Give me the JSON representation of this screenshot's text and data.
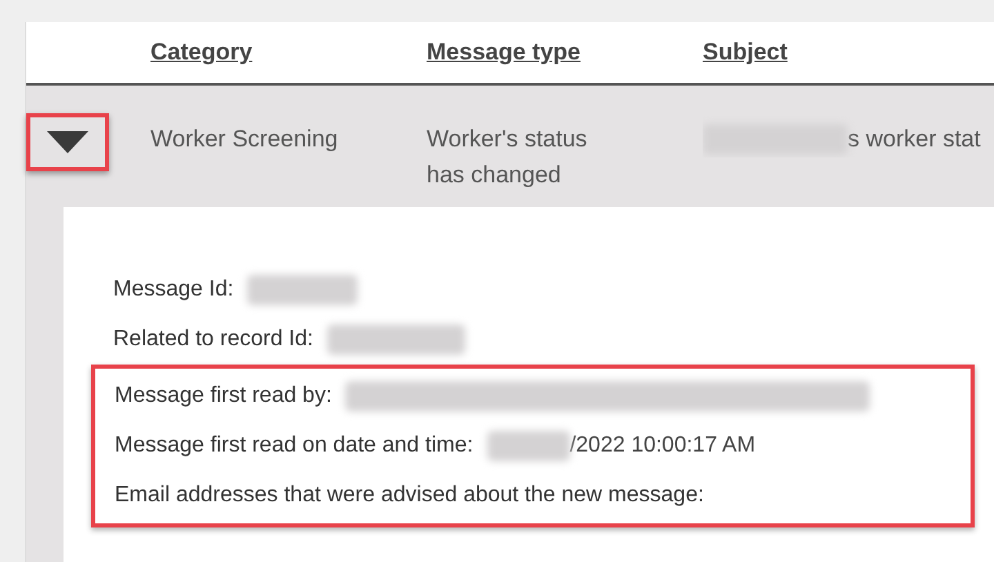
{
  "table": {
    "columns": [
      {
        "label": "Category"
      },
      {
        "label": "Message type"
      },
      {
        "label": "Subject"
      }
    ],
    "rows": [
      {
        "expanded": true,
        "toggle_highlighted": true,
        "category": "Worker Screening",
        "message_type": "Worker's status has changed",
        "subject": {
          "redacted": true,
          "text": "s worker stat"
        },
        "details": [
          {
            "label": "Message Id:",
            "redacted": true,
            "highlighted": false
          },
          {
            "label": "Related to record Id:",
            "redacted": true,
            "highlighted": false
          },
          {
            "label": "Message first read by:",
            "redacted": true,
            "highlighted": true
          },
          {
            "label": "Message first read on date and time:",
            "redacted": true,
            "value": "/2022 10:00:17 AM",
            "highlighted": true
          },
          {
            "label": "Email addresses that were advised about the new message:",
            "redacted": false,
            "highlighted": true
          }
        ]
      }
    ]
  }
}
